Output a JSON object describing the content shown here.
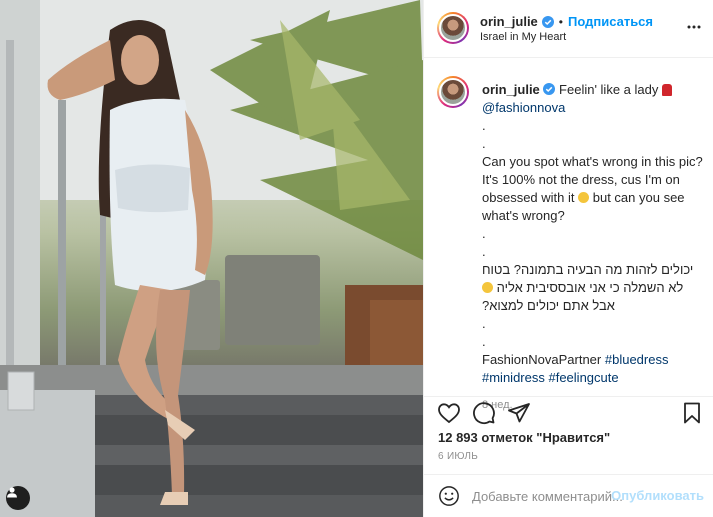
{
  "post": {
    "username": "orin_julie",
    "location": "Israel in My Heart",
    "follow_label": "Подписаться",
    "dot": "•"
  },
  "caption": {
    "username": "orin_julie",
    "first_line": "Feelin' like a lady",
    "mention": "@fashionnova",
    "dot1": ".",
    "dot2": ".",
    "para_en_1": "Can you spot what's wrong in this pic? It's 100% not the dress, cus I'm on obsessed with it",
    "para_en_2": "but can you see what's wrong?",
    "dot3": ".",
    "dot4": ".",
    "he_line1": "יכולים לזהות מה הבעיה בתמונה? בטוח",
    "he_line2": "לא השמלה כי אני אובססיבית אליה",
    "he_line3": "אבל אתם יכולים למצוא?",
    "dot5": ".",
    "dot6": ".",
    "partner": "FashionNovaPartner",
    "tag1": "#bluedress",
    "tag2": "#minidress",
    "tag3": "#feelingcute",
    "age": "8 нед."
  },
  "stats": {
    "likes": "12 893 отметок \"Нравится\"",
    "date": "6 ИЮЛЬ"
  },
  "comment": {
    "placeholder": "Добавьте комментарий...",
    "publish": "Опубликовать"
  },
  "icons": {
    "more": "more-horizontal-icon",
    "like": "heart-icon",
    "comment": "comment-icon",
    "share": "paper-plane-icon",
    "save": "bookmark-icon",
    "emoji": "smiley-icon",
    "verified": "verified-badge-icon",
    "user_tag": "user-tag-icon"
  },
  "colors": {
    "accent": "#0095f6",
    "link": "#00376b",
    "verified": "#3897f0",
    "muted": "#8e8e8e",
    "publish_disabled": "#b2dffc"
  }
}
